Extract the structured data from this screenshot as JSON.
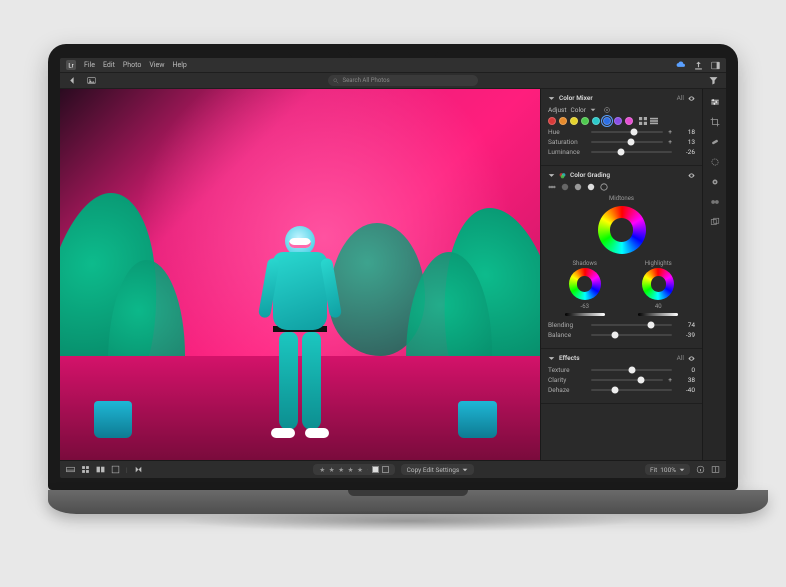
{
  "menubar": {
    "items": [
      "File",
      "Edit",
      "Photo",
      "View",
      "Help"
    ]
  },
  "search": {
    "placeholder": "Search All Photos"
  },
  "panels": {
    "colorMixer": {
      "title": "Color Mixer",
      "adjustLabel": "Adjust",
      "adjustMode": "Color",
      "setting": "All",
      "swatches": [
        "#d83a3a",
        "#e58a2c",
        "#e5d22c",
        "#4ec94e",
        "#2cc9c9",
        "#2c6fe5",
        "#8a4ee5",
        "#e54ed2"
      ],
      "selectedSwatch": 5,
      "sliders": [
        {
          "label": "Hue",
          "value": 18,
          "pos": 59
        },
        {
          "label": "Saturation",
          "value": 13,
          "pos": 56
        },
        {
          "label": "Luminance",
          "value": -26,
          "pos": 37
        }
      ]
    },
    "colorGrading": {
      "title": "Color Grading",
      "labels": {
        "mid": "Midtones",
        "sh": "Shadows",
        "hi": "Highlights"
      },
      "subValues": {
        "sh": "-63",
        "hi": "40"
      },
      "blending": {
        "label": "Blending",
        "value": 74,
        "pos": 74
      },
      "balance": {
        "label": "Balance",
        "value": -39,
        "pos": 30
      }
    },
    "effects": {
      "title": "Effects",
      "setting": "All",
      "sliders": [
        {
          "label": "Texture",
          "value": 0,
          "pos": 50
        },
        {
          "label": "Clarity",
          "value": 38,
          "pos": 69
        },
        {
          "label": "Dehaze",
          "value": -40,
          "pos": 30
        }
      ]
    }
  },
  "bottom": {
    "copyBtn": "Copy Edit Settings",
    "fitLabel": "Fit",
    "zoom": "100%"
  }
}
